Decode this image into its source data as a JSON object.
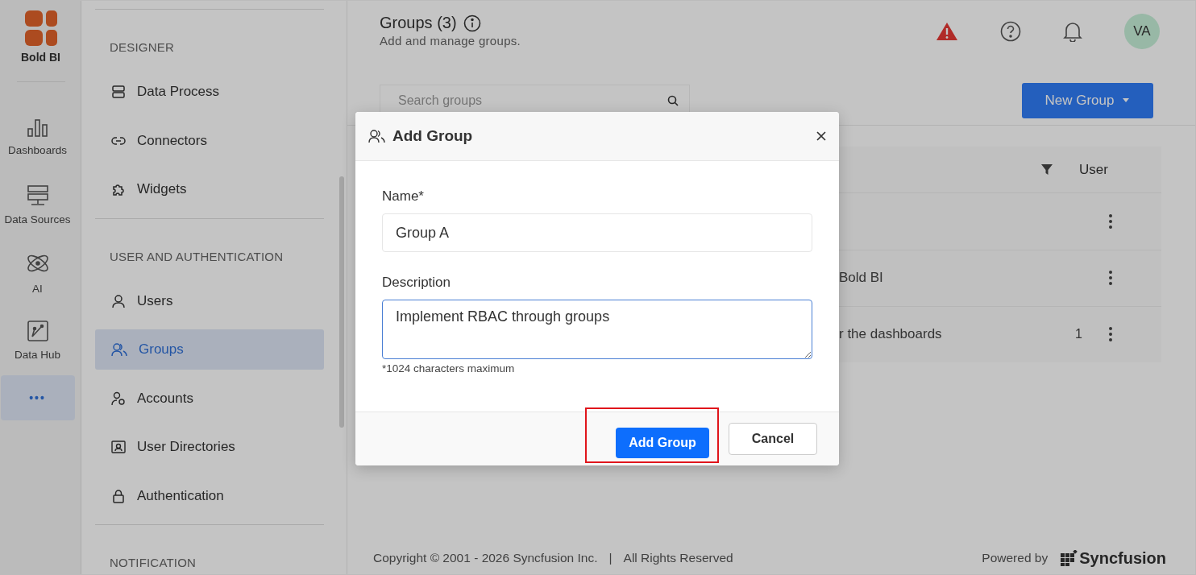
{
  "rail": {
    "logo_label": "Bold BI",
    "items": [
      {
        "kind": "dashboards",
        "label": "Dashboards",
        "selected": false
      },
      {
        "kind": "datasources",
        "label": "Data Sources",
        "selected": false
      },
      {
        "kind": "ai",
        "label": "AI",
        "selected": false
      },
      {
        "kind": "datahub",
        "label": "Data Hub",
        "selected": false
      },
      {
        "kind": "more",
        "label": "•••",
        "selected": true
      }
    ]
  },
  "nav": {
    "sections": [
      {
        "heading": "DESIGNER",
        "items": [
          {
            "kind": "dataprocess",
            "label": "Data Process",
            "selected": false
          },
          {
            "kind": "connectors",
            "label": "Connectors",
            "selected": false
          },
          {
            "kind": "widgets",
            "label": "Widgets",
            "selected": false
          }
        ]
      },
      {
        "heading": "USER AND AUTHENTICATION",
        "items": [
          {
            "kind": "users",
            "label": "Users",
            "selected": false
          },
          {
            "kind": "groups",
            "label": "Groups",
            "selected": true
          },
          {
            "kind": "accounts",
            "label": "Accounts",
            "selected": false
          },
          {
            "kind": "directories",
            "label": "User Directories",
            "selected": false
          },
          {
            "kind": "auth",
            "label": "Authentication",
            "selected": false
          }
        ]
      },
      {
        "heading": "NOTIFICATION"
      }
    ]
  },
  "header": {
    "title": "Groups (3)",
    "subtitle": "Add and manage groups.",
    "avatar": "VA"
  },
  "search": {
    "placeholder": "Search groups"
  },
  "new_group_button": "New Group",
  "table": {
    "columns": [
      {
        "label": "User"
      }
    ],
    "rows": [
      {},
      {
        "text": "Bold BI"
      },
      {
        "text": "r the dashboards",
        "users": "1"
      }
    ]
  },
  "dialog": {
    "title": "Add Group",
    "fields": [
      {
        "kind": "input",
        "label": "Name*",
        "value": "Group A"
      },
      {
        "kind": "textarea",
        "label": "Description",
        "value": "Implement RBAC through groups ",
        "hint": "*1024 characters maximum"
      }
    ],
    "buttons": [
      {
        "kind": "primary",
        "label": "Add Group",
        "highlighted": true
      },
      {
        "kind": "secondary",
        "label": "Cancel",
        "highlighted": false
      }
    ]
  },
  "footer": {
    "copyright": "Copyright © 2001 - 2026 Syncfusion Inc.",
    "separator": "|",
    "rights": "All Rights Reserved",
    "powered_by": "Powered by",
    "brand": "Syncfusion"
  }
}
